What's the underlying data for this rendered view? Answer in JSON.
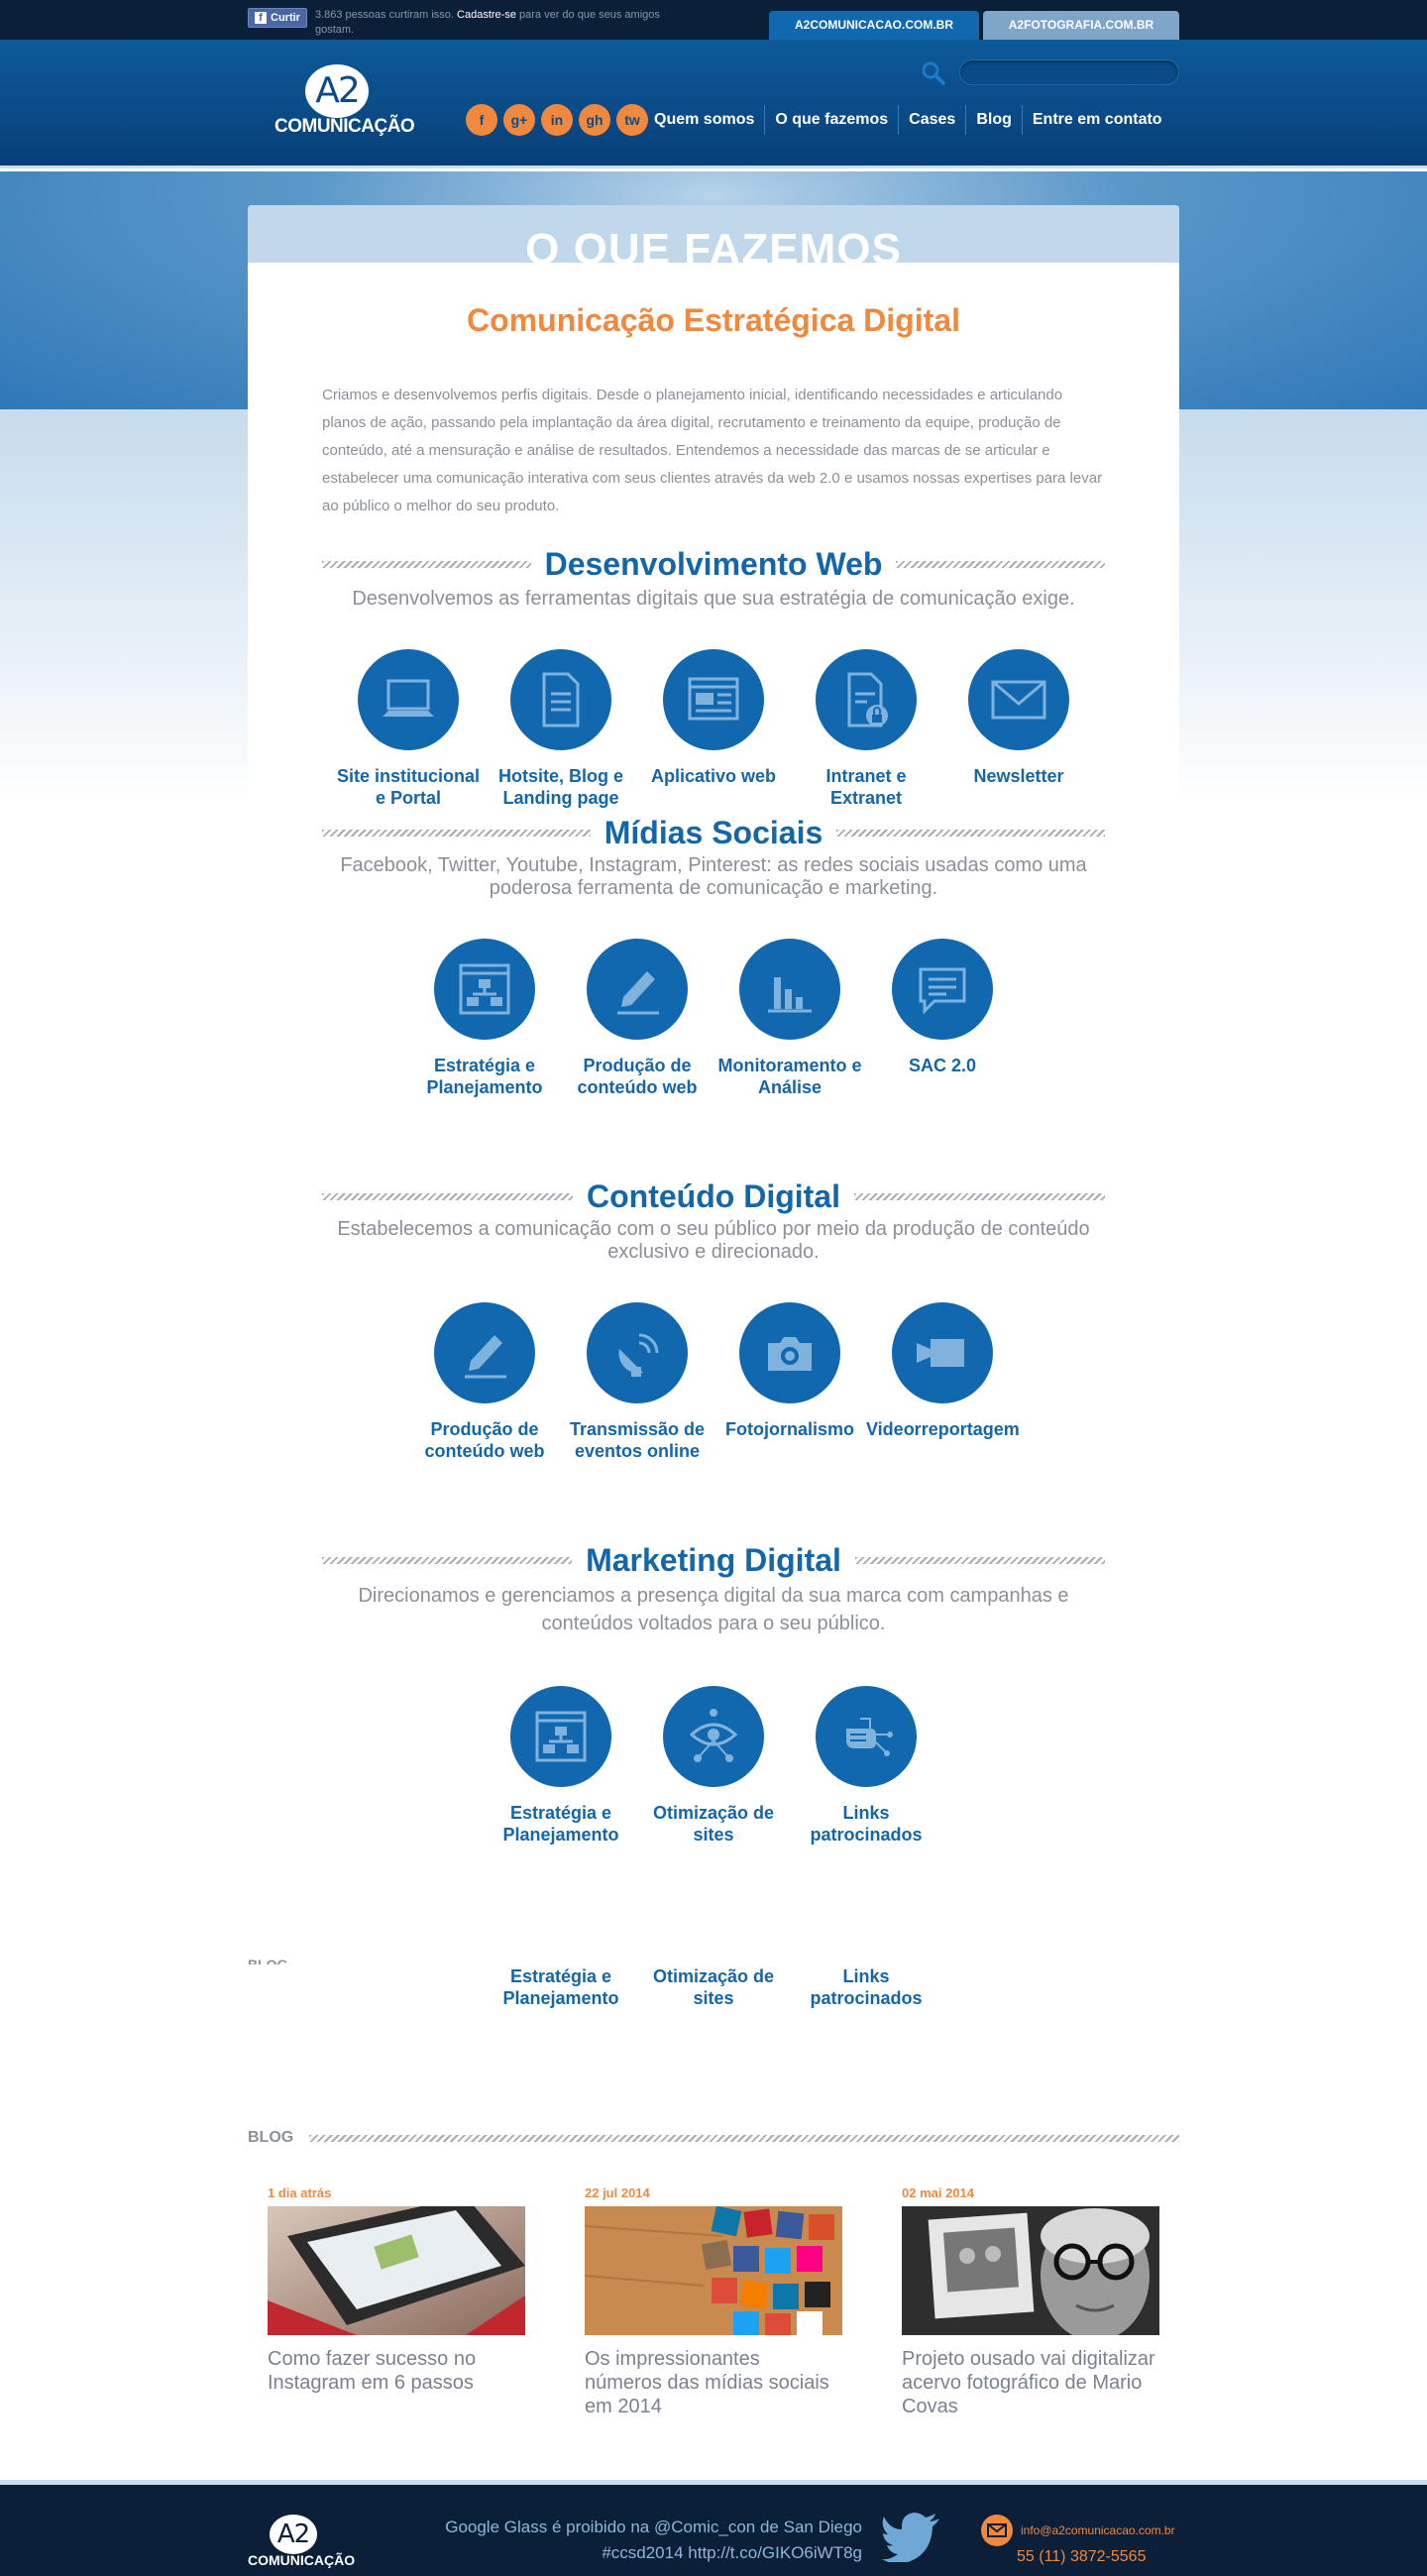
{
  "topbar": {
    "fb_button": "Curtir",
    "fb_text_count": "3.863 pessoas curtiram isso.",
    "fb_text_signup": "Cadastre-se",
    "fb_text_rest": "para ver do que seus amigos gostam.",
    "tabs": [
      {
        "label": "A2COMUNICACAO.COM.BR"
      },
      {
        "label": "A2FOTOGRAFIA.COM.BR"
      }
    ]
  },
  "header": {
    "logo_mark": "A2",
    "logo_text": "COMUNICAÇÃO",
    "search_placeholder": "",
    "social": [
      "f",
      "g+",
      "in",
      "gh",
      "tw"
    ],
    "nav": [
      {
        "label": "Quem somos"
      },
      {
        "label": "O que fazemos"
      },
      {
        "label": "Cases"
      },
      {
        "label": "Blog"
      },
      {
        "label": "Entre em contato"
      }
    ]
  },
  "page": {
    "title": "O QUE FAZEMOS",
    "subtitle": "Comunicação Estratégica Digital",
    "intro": "Criamos e desenvolvemos perfis digitais. Desde o planejamento inicial, identificando necessidades e articulando planos de ação, passando pela implantação da área digital, recrutamento e treinamento da equipe, produção de conteúdo, até a mensuração e análise de resultados. Entendemos a necessidade das marcas de se articular e estabelecer uma comunicação interativa com seus clientes através da web 2.0 e usamos nossas expertises para levar ao público o melhor do seu produto."
  },
  "sections": [
    {
      "title": "Desenvolvimento Web",
      "desc": "Desenvolvemos as ferramentas digitais que sua estratégia de comunicação exige.",
      "items": [
        {
          "label": "Site institucional e Portal",
          "icon": "laptop-icon"
        },
        {
          "label": "Hotsite, Blog e Landing page",
          "icon": "document-icon"
        },
        {
          "label": "Aplicativo web",
          "icon": "browser-window-icon"
        },
        {
          "label": "Intranet e Extranet",
          "icon": "locked-document-icon"
        },
        {
          "label": "Newsletter",
          "icon": "envelope-icon"
        }
      ]
    },
    {
      "title": "Mídias Sociais",
      "desc": "Facebook, Twitter, Youtube, Instagram, Pinterest: as redes sociais usadas como uma poderosa ferramenta de comunicação e marketing.",
      "items": [
        {
          "label": "Estratégia e Planejamento",
          "icon": "org-chart-icon"
        },
        {
          "label": "Produção de conteúdo web",
          "icon": "pencil-icon"
        },
        {
          "label": "Monitoramento e Análise",
          "icon": "bar-chart-icon"
        },
        {
          "label": "SAC 2.0",
          "icon": "speech-bubble-icon"
        }
      ]
    },
    {
      "title": "Conteúdo Digital",
      "desc": "Estabelecemos a comunicação com o seu público por meio da produção de conteúdo exclusivo e direcionado.",
      "items": [
        {
          "label": "Produção de conteúdo web",
          "icon": "pencil-icon"
        },
        {
          "label": "Transmissão de eventos online",
          "icon": "satellite-dish-icon"
        },
        {
          "label": "Fotojornalismo",
          "icon": "camera-icon"
        },
        {
          "label": "Videorreportagem",
          "icon": "video-camera-icon"
        }
      ]
    },
    {
      "title": "Marketing Digital",
      "desc": "Direcionamos e gerenciamos a presença digital da sua marca com campanhas e conteúdos voltados para o seu público.",
      "items": [
        {
          "label": "Estratégia e Planejamento",
          "icon": "org-chart-icon"
        },
        {
          "label": "Otimização de sites",
          "icon": "eye-network-icon"
        },
        {
          "label": "Links patrocinados",
          "icon": "hand-cursor-icon"
        }
      ]
    }
  ],
  "ghost": {
    "blog_label": "BLOG",
    "items": [
      "Estratégia e Planejamento",
      "Otimização de sites",
      "Links patrocinados"
    ]
  },
  "blog": {
    "label": "BLOG",
    "posts": [
      {
        "date": "1 dia atrás",
        "title": "Como fazer sucesso no Instagram em 6 passos"
      },
      {
        "date": "22 jul 2014",
        "title": "Os impressionantes números das mídias sociais em 2014"
      },
      {
        "date": "02 mai 2014",
        "title": "Projeto ousado vai digitalizar acervo fotográfico de Mario Covas"
      }
    ]
  },
  "footer": {
    "logo_mark": "A2",
    "logo_text": "COMUNICAÇÃO",
    "tweet_line1": "Google Glass é proibido na @Comic_con de San Diego",
    "tweet_line2": "#ccsd2014 http://t.co/GIKO6iWT8g",
    "email": "info@a2comunicacao.com.br",
    "phone": "55 (11) 3872-5565"
  },
  "colors": {
    "brand_blue": "#1168ae",
    "accent_orange": "#f0883e",
    "dark_navy": "#0b2038"
  }
}
